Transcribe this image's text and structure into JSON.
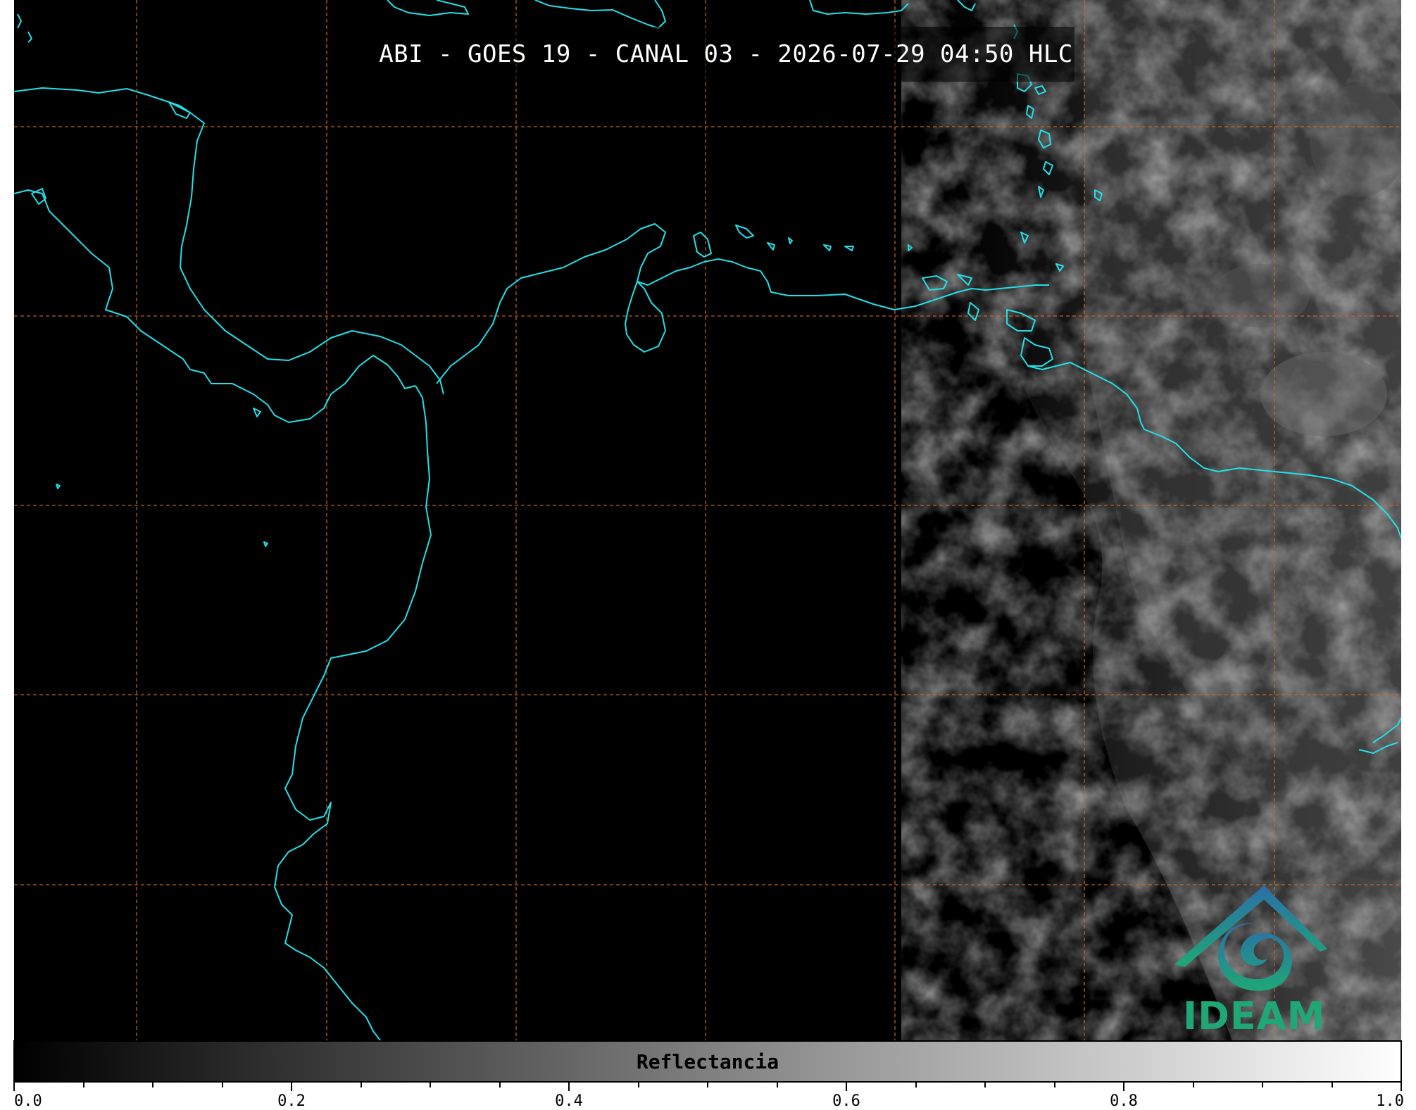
{
  "header": {
    "title": "ABI - GOES 19 - CANAL 03 - 2026-07-29 04:50 HLC"
  },
  "colorbar": {
    "label": "Reflectancia",
    "ticks": [
      "0.0",
      "0.2",
      "0.4",
      "0.6",
      "0.8",
      "1.0"
    ],
    "range": [
      0.0,
      1.0
    ],
    "colormap": [
      "#000000",
      "#ffffff"
    ]
  },
  "logo": {
    "text": "IDEAM",
    "colors": {
      "teal": "#1fa776",
      "blue": "#2a6fa8"
    }
  },
  "map": {
    "coastline_color": "#22e0e8",
    "gridline_color": "#d2691e",
    "background_color": "#000000"
  }
}
